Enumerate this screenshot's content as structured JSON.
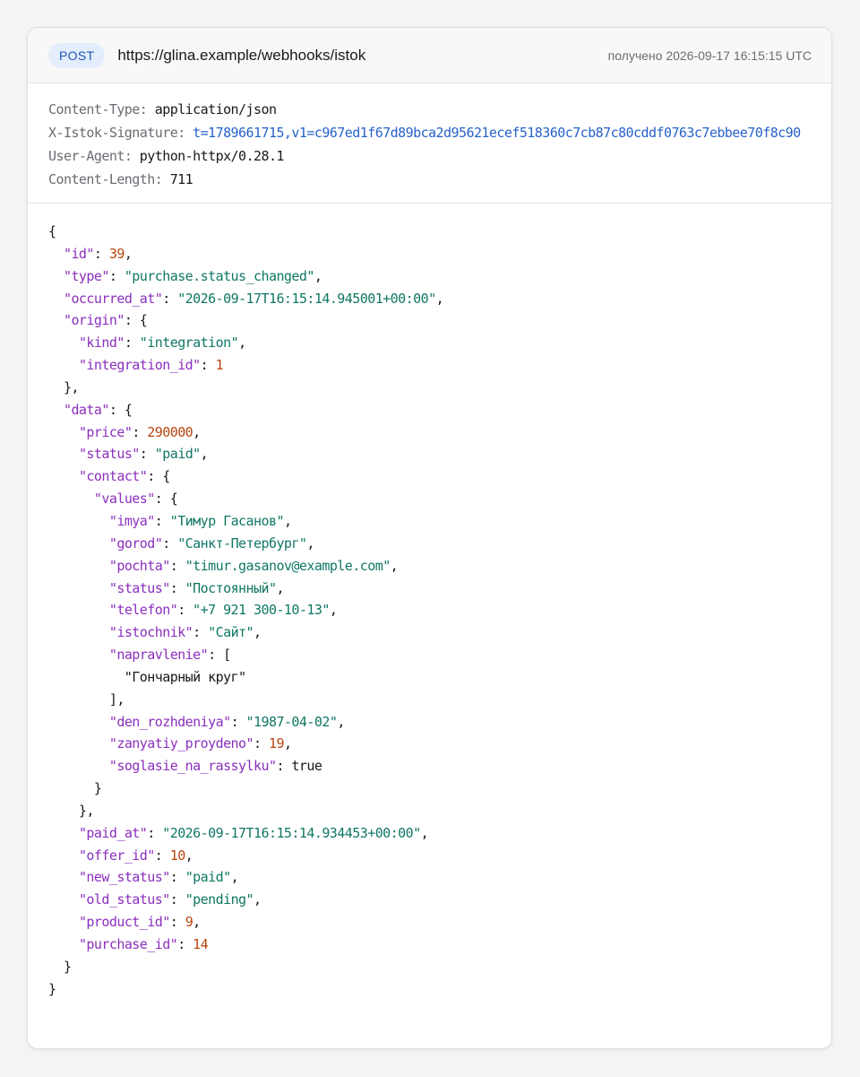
{
  "request": {
    "method": "POST",
    "url": "https://glina.example/webhooks/istok",
    "received": "получено 2026-09-17 16:15:15 UTC"
  },
  "headers": [
    {
      "name": "Content-Type",
      "value": "application/json",
      "link": false
    },
    {
      "name": "X-Istok-Signature",
      "value": "t=1789661715,v1=c967ed1f67d89bca2d95621ecef518360c7cb87c80cddf0763c7ebbee70f8c90",
      "link": true
    },
    {
      "name": "User-Agent",
      "value": "python-httpx/0.28.1",
      "link": false
    },
    {
      "name": "Content-Length",
      "value": "711",
      "link": false
    }
  ],
  "body_lines": [
    [
      [
        "p",
        "{"
      ]
    ],
    [
      [
        "p",
        "  "
      ],
      [
        "k",
        "\"id\""
      ],
      [
        "p",
        ": "
      ],
      [
        "n",
        "39"
      ],
      [
        "p",
        ","
      ]
    ],
    [
      [
        "p",
        "  "
      ],
      [
        "k",
        "\"type\""
      ],
      [
        "p",
        ": "
      ],
      [
        "s",
        "\"purchase.status_changed\""
      ],
      [
        "p",
        ","
      ]
    ],
    [
      [
        "p",
        "  "
      ],
      [
        "k",
        "\"occurred_at\""
      ],
      [
        "p",
        ": "
      ],
      [
        "s",
        "\"2026-09-17T16:15:14.945001+00:00\""
      ],
      [
        "p",
        ","
      ]
    ],
    [
      [
        "p",
        "  "
      ],
      [
        "k",
        "\"origin\""
      ],
      [
        "p",
        ": {"
      ]
    ],
    [
      [
        "p",
        "    "
      ],
      [
        "k",
        "\"kind\""
      ],
      [
        "p",
        ": "
      ],
      [
        "s",
        "\"integration\""
      ],
      [
        "p",
        ","
      ]
    ],
    [
      [
        "p",
        "    "
      ],
      [
        "k",
        "\"integration_id\""
      ],
      [
        "p",
        ": "
      ],
      [
        "n",
        "1"
      ]
    ],
    [
      [
        "p",
        "  },"
      ]
    ],
    [
      [
        "p",
        "  "
      ],
      [
        "k",
        "\"data\""
      ],
      [
        "p",
        ": {"
      ]
    ],
    [
      [
        "p",
        "    "
      ],
      [
        "k",
        "\"price\""
      ],
      [
        "p",
        ": "
      ],
      [
        "n",
        "290000"
      ],
      [
        "p",
        ","
      ]
    ],
    [
      [
        "p",
        "    "
      ],
      [
        "k",
        "\"status\""
      ],
      [
        "p",
        ": "
      ],
      [
        "s",
        "\"paid\""
      ],
      [
        "p",
        ","
      ]
    ],
    [
      [
        "p",
        "    "
      ],
      [
        "k",
        "\"contact\""
      ],
      [
        "p",
        ": {"
      ]
    ],
    [
      [
        "p",
        "      "
      ],
      [
        "k",
        "\"values\""
      ],
      [
        "p",
        ": {"
      ]
    ],
    [
      [
        "p",
        "        "
      ],
      [
        "k",
        "\"imya\""
      ],
      [
        "p",
        ": "
      ],
      [
        "s",
        "\"Тимур Гасанов\""
      ],
      [
        "p",
        ","
      ]
    ],
    [
      [
        "p",
        "        "
      ],
      [
        "k",
        "\"gorod\""
      ],
      [
        "p",
        ": "
      ],
      [
        "s",
        "\"Санкт-Петербург\""
      ],
      [
        "p",
        ","
      ]
    ],
    [
      [
        "p",
        "        "
      ],
      [
        "k",
        "\"pochta\""
      ],
      [
        "p",
        ": "
      ],
      [
        "s",
        "\"timur.gasanov@example.com\""
      ],
      [
        "p",
        ","
      ]
    ],
    [
      [
        "p",
        "        "
      ],
      [
        "k",
        "\"status\""
      ],
      [
        "p",
        ": "
      ],
      [
        "s",
        "\"Постоянный\""
      ],
      [
        "p",
        ","
      ]
    ],
    [
      [
        "p",
        "        "
      ],
      [
        "k",
        "\"telefon\""
      ],
      [
        "p",
        ": "
      ],
      [
        "s",
        "\"+7 921 300-10-13\""
      ],
      [
        "p",
        ","
      ]
    ],
    [
      [
        "p",
        "        "
      ],
      [
        "k",
        "\"istochnik\""
      ],
      [
        "p",
        ": "
      ],
      [
        "s",
        "\"Сайт\""
      ],
      [
        "p",
        ","
      ]
    ],
    [
      [
        "p",
        "        "
      ],
      [
        "k",
        "\"napravlenie\""
      ],
      [
        "p",
        ": ["
      ]
    ],
    [
      [
        "p",
        "          \"Гончарный круг\""
      ]
    ],
    [
      [
        "p",
        "        ],"
      ]
    ],
    [
      [
        "p",
        "        "
      ],
      [
        "k",
        "\"den_rozhdeniya\""
      ],
      [
        "p",
        ": "
      ],
      [
        "s",
        "\"1987-04-02\""
      ],
      [
        "p",
        ","
      ]
    ],
    [
      [
        "p",
        "        "
      ],
      [
        "k",
        "\"zanyatiy_proydeno\""
      ],
      [
        "p",
        ": "
      ],
      [
        "n",
        "19"
      ],
      [
        "p",
        ","
      ]
    ],
    [
      [
        "p",
        "        "
      ],
      [
        "k",
        "\"soglasie_na_rassylku\""
      ],
      [
        "p",
        ": "
      ],
      [
        "b",
        "true"
      ]
    ],
    [
      [
        "p",
        "      }"
      ]
    ],
    [
      [
        "p",
        "    },"
      ]
    ],
    [
      [
        "p",
        "    "
      ],
      [
        "k",
        "\"paid_at\""
      ],
      [
        "p",
        ": "
      ],
      [
        "s",
        "\"2026-09-17T16:15:14.934453+00:00\""
      ],
      [
        "p",
        ","
      ]
    ],
    [
      [
        "p",
        "    "
      ],
      [
        "k",
        "\"offer_id\""
      ],
      [
        "p",
        ": "
      ],
      [
        "n",
        "10"
      ],
      [
        "p",
        ","
      ]
    ],
    [
      [
        "p",
        "    "
      ],
      [
        "k",
        "\"new_status\""
      ],
      [
        "p",
        ": "
      ],
      [
        "s",
        "\"paid\""
      ],
      [
        "p",
        ","
      ]
    ],
    [
      [
        "p",
        "    "
      ],
      [
        "k",
        "\"old_status\""
      ],
      [
        "p",
        ": "
      ],
      [
        "s",
        "\"pending\""
      ],
      [
        "p",
        ","
      ]
    ],
    [
      [
        "p",
        "    "
      ],
      [
        "k",
        "\"product_id\""
      ],
      [
        "p",
        ": "
      ],
      [
        "n",
        "9"
      ],
      [
        "p",
        ","
      ]
    ],
    [
      [
        "p",
        "    "
      ],
      [
        "k",
        "\"purchase_id\""
      ],
      [
        "p",
        ": "
      ],
      [
        "n",
        "14"
      ]
    ],
    [
      [
        "p",
        "  }"
      ]
    ],
    [
      [
        "p",
        "}"
      ]
    ]
  ]
}
